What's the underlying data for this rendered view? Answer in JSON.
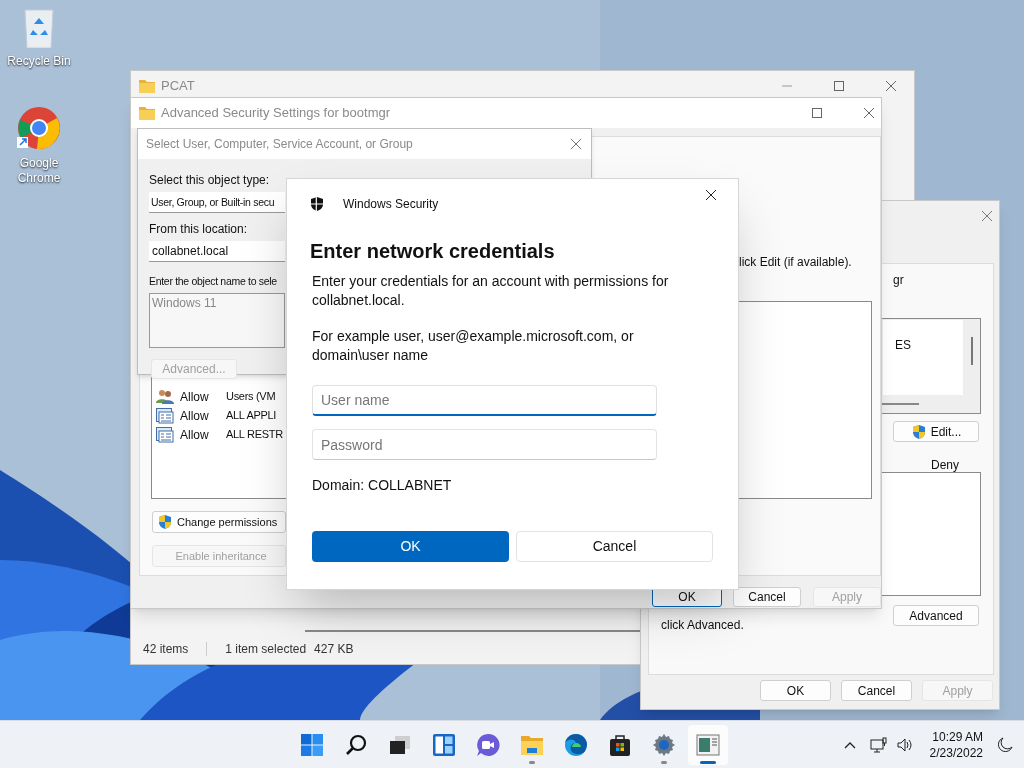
{
  "desktop_icons": [
    {
      "kind": "recycle_bin",
      "label": "Recycle Bin"
    },
    {
      "kind": "browser",
      "label": "Google Chrome"
    }
  ],
  "explorer_window": {
    "title": "PCAT",
    "status_bar": [
      "42 items",
      "1 item selected",
      "427 KB"
    ]
  },
  "properties_window": {
    "label_fragment": "gr",
    "list_items": [
      "ES"
    ],
    "edit_button": "Edit...",
    "column_header": "Deny",
    "advanced_button": "Advanced",
    "note": "click Advanced.",
    "buttons": [
      {
        "label": "OK",
        "disabled": false
      },
      {
        "label": "Cancel",
        "disabled": false
      },
      {
        "label": "Apply",
        "disabled": true
      }
    ]
  },
  "advanced_security_window": {
    "title": "Advanced Security Settings for bootmgr",
    "instruction": "lick Edit (if available).",
    "entries": [
      {
        "kind": "group",
        "type": "Allow",
        "principal": "Users (VM"
      },
      {
        "kind": "package",
        "type": "Allow",
        "principal": "ALL APPLI"
      },
      {
        "kind": "package",
        "type": "Allow",
        "principal": "ALL RESTR"
      }
    ],
    "side_buttons": [
      {
        "label": "Change permissions",
        "shield": true,
        "disabled": false
      },
      {
        "label": "Enable inheritance",
        "shield": false,
        "disabled": true
      }
    ],
    "buttons": [
      {
        "label": "OK",
        "disabled": false,
        "default": true
      },
      {
        "label": "Cancel",
        "disabled": false,
        "default": false
      },
      {
        "label": "Apply",
        "disabled": true,
        "default": false
      }
    ]
  },
  "select_user_dialog": {
    "title": "Select User, Computer, Service Account, or Group",
    "object_type_label": "Select this object type:",
    "object_type": "User, Group, or Built-in secu",
    "location_label": "From this location:",
    "location": "collabnet.local",
    "object_name_label": "Enter the object name to sele",
    "object_name": "Windows 11",
    "advanced_button": {
      "label": "Advanced...",
      "disabled": true
    }
  },
  "credentials_dialog": {
    "app_title": "Windows Security",
    "heading": "Enter network credentials",
    "message": "Enter your credentials for an account with permissions for collabnet.local.",
    "example": "For example user, user@example.microsoft.com, or domain\\user name",
    "fields": [
      {
        "placeholder": "User name",
        "focused": true
      },
      {
        "placeholder": "Password",
        "focused": false
      }
    ],
    "domain": "Domain: COLLABNET",
    "buttons": [
      {
        "label": "OK",
        "primary": true
      },
      {
        "label": "Cancel",
        "primary": false
      }
    ]
  },
  "taskbar": {
    "items": [
      {
        "kind": "start",
        "running": false,
        "selected": false
      },
      {
        "kind": "search",
        "running": false,
        "selected": false
      },
      {
        "kind": "task_view",
        "running": false,
        "selected": false
      },
      {
        "kind": "widgets",
        "running": false,
        "selected": false
      },
      {
        "kind": "chat",
        "running": false,
        "selected": false
      },
      {
        "kind": "file_explorer",
        "running": true,
        "selected": false
      },
      {
        "kind": "edge",
        "running": false,
        "selected": false
      },
      {
        "kind": "store",
        "running": false,
        "selected": false
      },
      {
        "kind": "settings",
        "running": true,
        "selected": false
      },
      {
        "kind": "app",
        "running": true,
        "selected": true
      }
    ],
    "time": "10:29 AM",
    "date": "2/23/2022"
  }
}
